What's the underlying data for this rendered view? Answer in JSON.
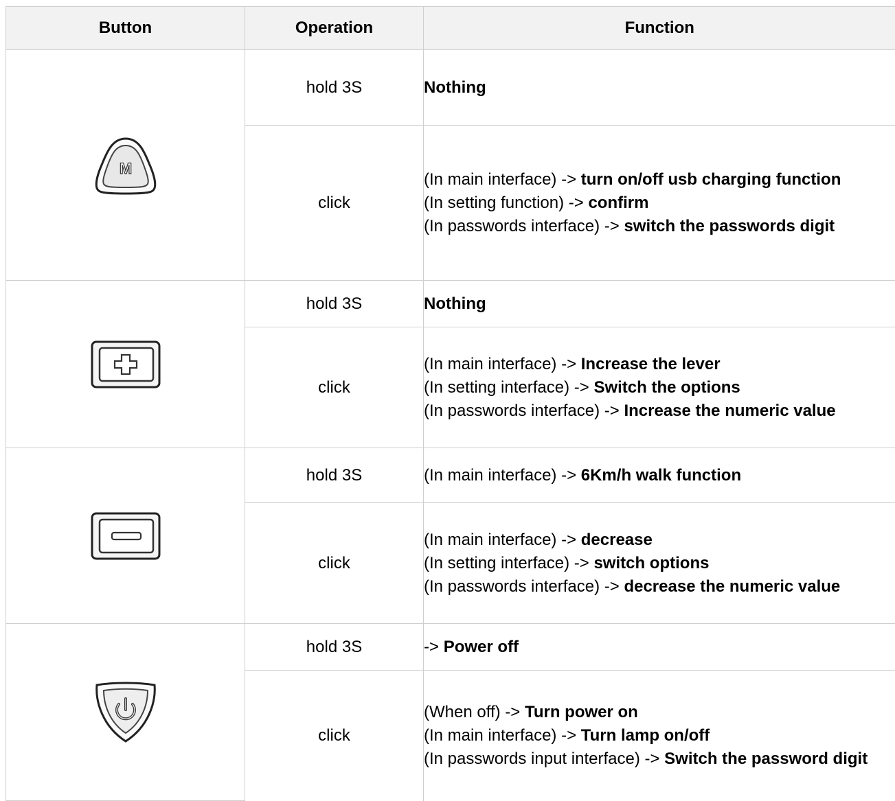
{
  "headers": {
    "button": "Button",
    "operation": "Operation",
    "function": "Function"
  },
  "rows": [
    {
      "button_icon": "m-button-icon",
      "ops": [
        {
          "operation": "hold 3S",
          "function": [
            {
              "lead": "",
              "bold": "Nothing"
            }
          ]
        },
        {
          "operation": "click",
          "function": [
            {
              "lead": "(In main interface) -> ",
              "bold": "turn on/off usb charging function"
            },
            {
              "lead": "(In setting function) -> ",
              "bold": "confirm"
            },
            {
              "lead": "(In passwords interface) -> ",
              "bold": "switch the passwords digit"
            }
          ]
        }
      ]
    },
    {
      "button_icon": "plus-button-icon",
      "ops": [
        {
          "operation": "hold 3S",
          "function": [
            {
              "lead": "",
              "bold": "Nothing"
            }
          ]
        },
        {
          "operation": "click",
          "function": [
            {
              "lead": "(In main interface) -> ",
              "bold": "Increase the lever"
            },
            {
              "lead": "(In setting interface) -> ",
              "bold": "Switch the options"
            },
            {
              "lead": "(In passwords interface) -> ",
              "bold": "Increase the numeric value"
            }
          ]
        }
      ]
    },
    {
      "button_icon": "minus-button-icon",
      "ops": [
        {
          "operation": "hold 3S",
          "function": [
            {
              "lead": "(In main interface) -> ",
              "bold": "6Km/h walk function"
            }
          ]
        },
        {
          "operation": "click",
          "function": [
            {
              "lead": "(In main interface) -> ",
              "bold": "decrease"
            },
            {
              "lead": "(In setting interface) -> ",
              "bold": "switch options"
            },
            {
              "lead": "(In passwords interface) -> ",
              "bold": "decrease the numeric value"
            }
          ]
        }
      ]
    },
    {
      "button_icon": "power-button-icon",
      "ops": [
        {
          "operation": "hold 3S",
          "function": [
            {
              "lead": "-> ",
              "bold": "Power off"
            }
          ]
        },
        {
          "operation": "click",
          "function": [
            {
              "lead": "(When off) -> ",
              "bold": "Turn power on"
            },
            {
              "lead": "(In main interface) -> ",
              "bold": "Turn lamp on/off"
            },
            {
              "lead": "(In passwords input interface) -> ",
              "bold": "Switch the password digit"
            }
          ]
        }
      ]
    }
  ]
}
